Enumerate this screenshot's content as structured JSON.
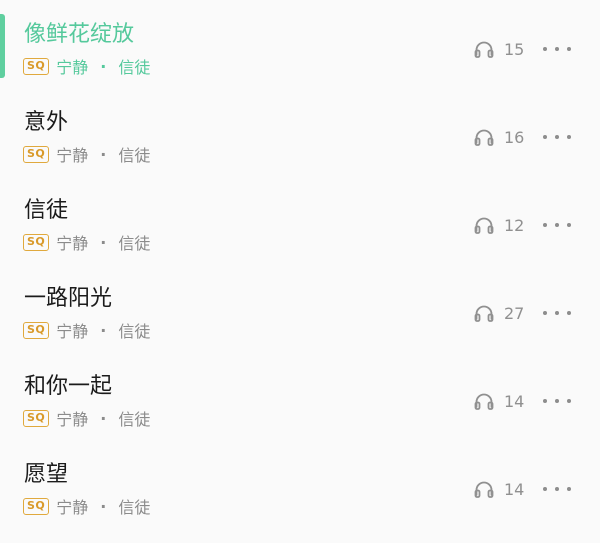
{
  "songs": [
    {
      "title": "像鲜花绽放",
      "quality": "SQ",
      "album": "宁静",
      "separator": "·",
      "artist": "信徒",
      "plays": "15",
      "active": true
    },
    {
      "title": "意外",
      "quality": "SQ",
      "album": "宁静",
      "separator": "·",
      "artist": "信徒",
      "plays": "16",
      "active": false
    },
    {
      "title": "信徒",
      "quality": "SQ",
      "album": "宁静",
      "separator": "·",
      "artist": "信徒",
      "plays": "12",
      "active": false
    },
    {
      "title": "一路阳光",
      "quality": "SQ",
      "album": "宁静",
      "separator": "·",
      "artist": "信徒",
      "plays": "27",
      "active": false
    },
    {
      "title": "和你一起",
      "quality": "SQ",
      "album": "宁静",
      "separator": "·",
      "artist": "信徒",
      "plays": "14",
      "active": false
    },
    {
      "title": "愿望",
      "quality": "SQ",
      "album": "宁静",
      "separator": "·",
      "artist": "信徒",
      "plays": "14",
      "active": false
    }
  ],
  "colors": {
    "accent": "#55c99c",
    "sq_badge": "#e0a93d",
    "secondary_text": "#8b8b8b",
    "primary_text": "#1b1b1b"
  },
  "icons": {
    "plays": "headphones-icon",
    "more": "more-dots-icon"
  }
}
